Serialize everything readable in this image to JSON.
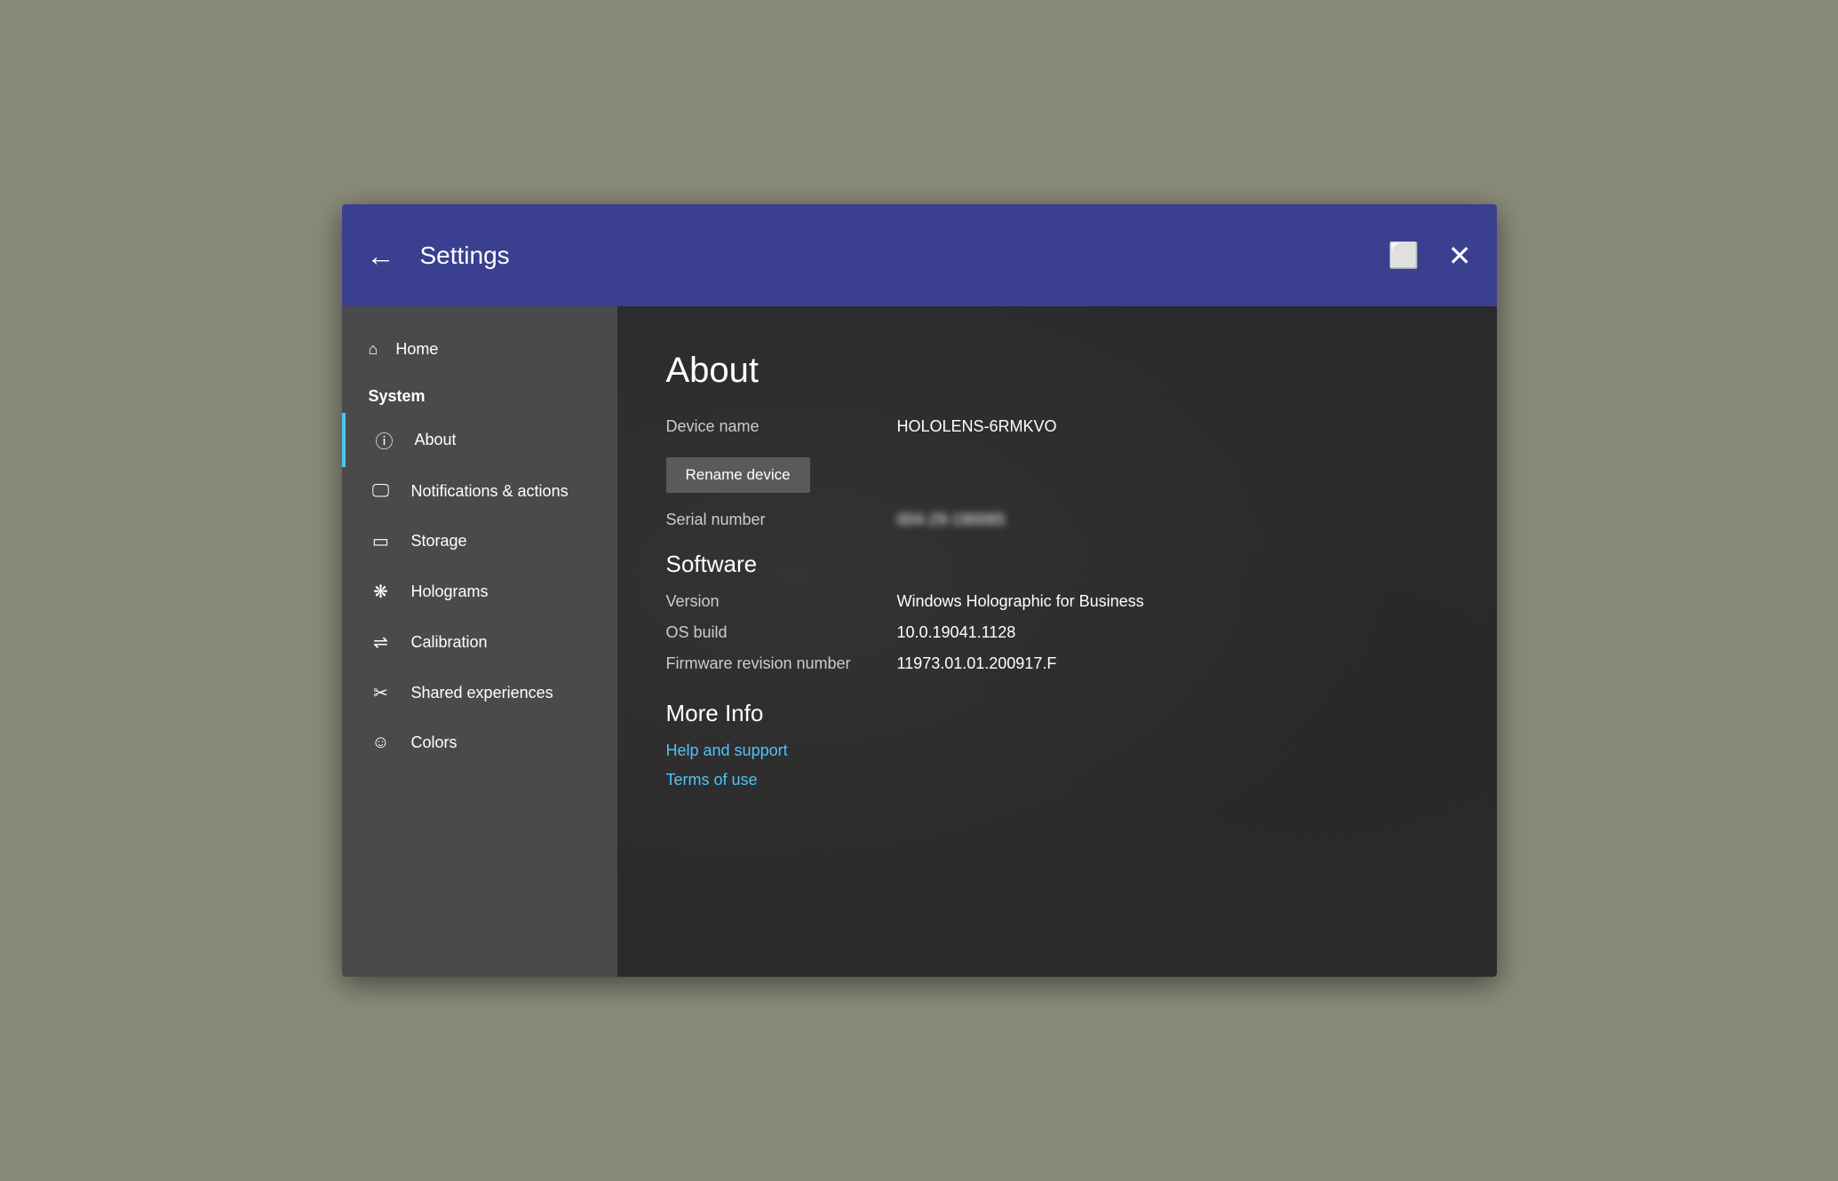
{
  "titlebar": {
    "back_label": "←",
    "title": "Settings",
    "window_icon": "⬜",
    "close_icon": "✕"
  },
  "sidebar": {
    "home_label": "Home",
    "home_icon": "⌂",
    "system_label": "System",
    "items": [
      {
        "id": "about",
        "label": "About",
        "icon": "ℹ",
        "active": true
      },
      {
        "id": "notifications",
        "label": "Notifications & actions",
        "icon": "🖵",
        "active": false
      },
      {
        "id": "storage",
        "label": "Storage",
        "icon": "▭",
        "active": false
      },
      {
        "id": "holograms",
        "label": "Holograms",
        "icon": "✦",
        "active": false
      },
      {
        "id": "calibration",
        "label": "Calibration",
        "icon": "⇌",
        "active": false
      },
      {
        "id": "shared",
        "label": "Shared experiences",
        "icon": "✂",
        "active": false
      },
      {
        "id": "colors",
        "label": "Colors",
        "icon": "☺",
        "active": false
      }
    ]
  },
  "main": {
    "page_title": "About",
    "device_name_label": "Device name",
    "device_name_value": "HOLOLENS-6RMKVO",
    "rename_button": "Rename device",
    "serial_label": "Serial number",
    "serial_value": "004-29-190065",
    "software_heading": "Software",
    "version_label": "Version",
    "version_value": "Windows Holographic for Business",
    "os_build_label": "OS build",
    "os_build_value": "10.0.19041.1128",
    "firmware_label": "Firmware revision number",
    "firmware_value": "11973.01.01.200917.F",
    "more_info_heading": "More Info",
    "help_link": "Help and support",
    "terms_link": "Terms of use"
  }
}
